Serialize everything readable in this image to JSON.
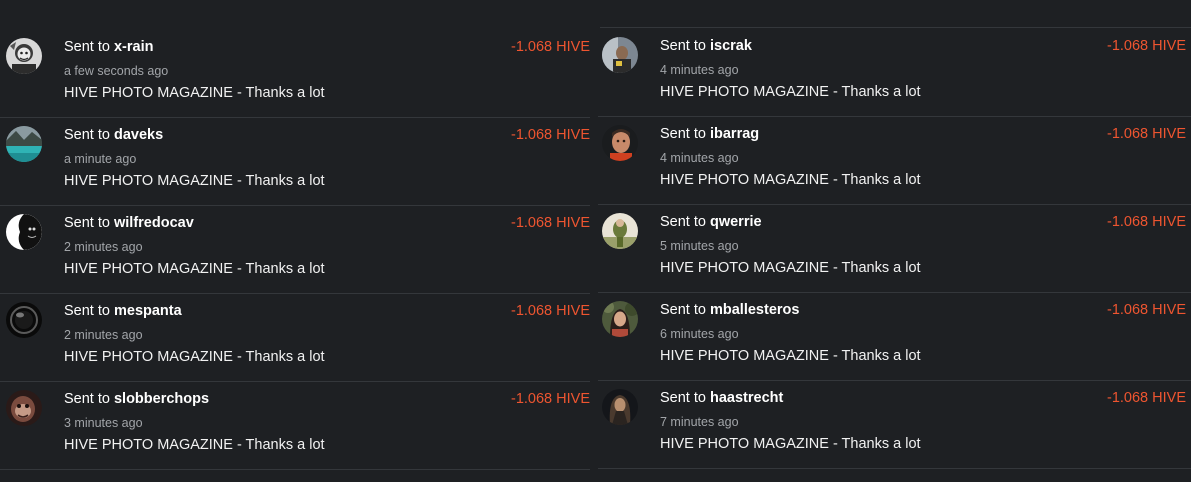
{
  "colors": {
    "background": "#1e2023",
    "divider": "#34373b",
    "amount": "#ee5530",
    "primary_text": "#ffffff",
    "secondary_text": "#a2a5a9"
  },
  "left": [
    {
      "prefix": "Sent to",
      "recipient": "x-rain",
      "time": "a few seconds ago",
      "memo": "HIVE PHOTO MAGAZINE - Thanks a lot",
      "amount": "-1.068 HIVE",
      "avatar_icon": "x-rain-avatar"
    },
    {
      "prefix": "Sent to",
      "recipient": "daveks",
      "time": "a minute ago",
      "memo": "HIVE PHOTO MAGAZINE - Thanks a lot",
      "amount": "-1.068 HIVE",
      "avatar_icon": "daveks-avatar"
    },
    {
      "prefix": "Sent to",
      "recipient": "wilfredocav",
      "time": "2 minutes ago",
      "memo": "HIVE PHOTO MAGAZINE - Thanks a lot",
      "amount": "-1.068 HIVE",
      "avatar_icon": "wilfredocav-avatar"
    },
    {
      "prefix": "Sent to",
      "recipient": "mespanta",
      "time": "2 minutes ago",
      "memo": "HIVE PHOTO MAGAZINE - Thanks a lot",
      "amount": "-1.068 HIVE",
      "avatar_icon": "mespanta-avatar"
    },
    {
      "prefix": "Sent to",
      "recipient": "slobberchops",
      "time": "3 minutes ago",
      "memo": "HIVE PHOTO MAGAZINE - Thanks a lot",
      "amount": "-1.068 HIVE",
      "avatar_icon": "slobberchops-avatar"
    }
  ],
  "right": [
    {
      "prefix": "Sent to",
      "recipient": "iscrak",
      "time": "4 minutes ago",
      "memo": "HIVE PHOTO MAGAZINE - Thanks a lot",
      "amount": "-1.068 HIVE",
      "avatar_icon": "iscrak-avatar"
    },
    {
      "prefix": "Sent to",
      "recipient": "ibarrag",
      "time": "4 minutes ago",
      "memo": "HIVE PHOTO MAGAZINE - Thanks a lot",
      "amount": "-1.068 HIVE",
      "avatar_icon": "ibarrag-avatar"
    },
    {
      "prefix": "Sent to",
      "recipient": "qwerrie",
      "time": "5 minutes ago",
      "memo": "HIVE PHOTO MAGAZINE - Thanks a lot",
      "amount": "-1.068 HIVE",
      "avatar_icon": "qwerrie-avatar"
    },
    {
      "prefix": "Sent to",
      "recipient": "mballesteros",
      "time": "6 minutes ago",
      "memo": "HIVE PHOTO MAGAZINE - Thanks a lot",
      "amount": "-1.068 HIVE",
      "avatar_icon": "mballesteros-avatar"
    },
    {
      "prefix": "Sent to",
      "recipient": "haastrecht",
      "time": "7 minutes ago",
      "memo": "HIVE PHOTO MAGAZINE - Thanks a lot",
      "amount": "-1.068 HIVE",
      "avatar_icon": "haastrecht-avatar"
    }
  ]
}
